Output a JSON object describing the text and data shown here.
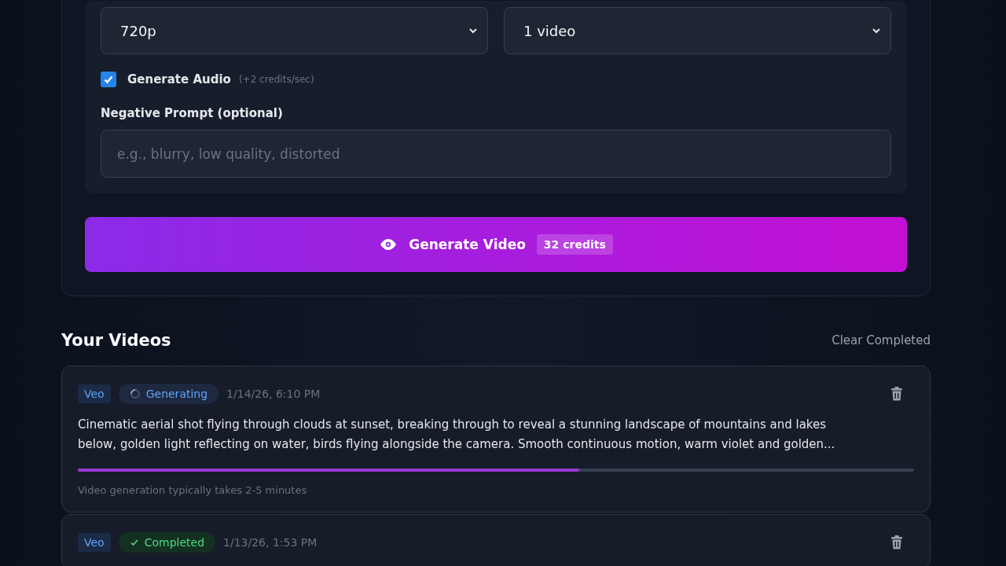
{
  "settings": {
    "selects": [
      {
        "value": "720p"
      },
      {
        "value": "1 video"
      }
    ],
    "audio": {
      "label": "Generate Audio",
      "note": "(+2 credits/sec)",
      "checked": true
    },
    "negative_prompt": {
      "label": "Negative Prompt (optional)",
      "placeholder": "e.g., blurry, low quality, distorted"
    },
    "generate_button": {
      "label": "Generate Video",
      "credits": "32 credits"
    }
  },
  "videos": {
    "title": "Your Videos",
    "clear_action": "Clear Completed",
    "items": [
      {
        "model": "Veo",
        "status": {
          "kind": "generating",
          "label": "Generating"
        },
        "time": "1/14/26, 6:10 PM",
        "prompt": "Cinematic aerial shot flying through clouds at sunset, breaking through to reveal a stunning landscape of mountains and lakes below, golden light reflecting on water, birds flying alongside the camera. Smooth continuous motion, warm violet and golden...",
        "level": 0.6,
        "hint": "Video generation typically takes 2-5 minutes"
      },
      {
        "model": "Veo",
        "status": {
          "kind": "completed",
          "label": "Completed"
        },
        "time": "1/13/26, 1:53 PM"
      }
    ]
  }
}
